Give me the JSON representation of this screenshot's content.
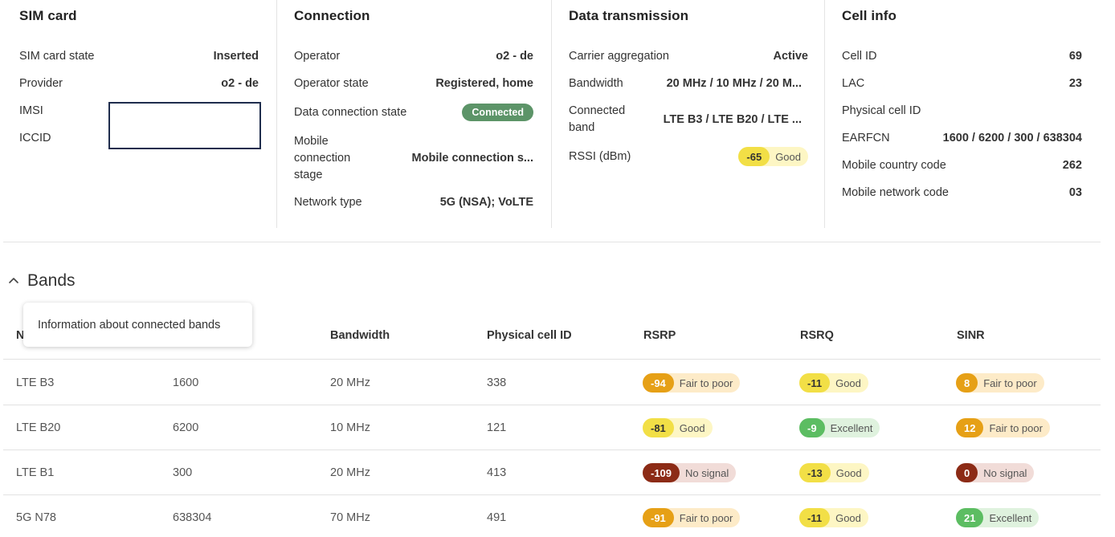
{
  "sim_card": {
    "title": "SIM card",
    "rows": [
      {
        "label": "SIM card state",
        "value": "Inserted"
      },
      {
        "label": "Provider",
        "value": "o2 - de"
      },
      {
        "label": "IMSI",
        "value": ""
      },
      {
        "label": "ICCID",
        "value": ""
      }
    ]
  },
  "connection": {
    "title": "Connection",
    "rows": [
      {
        "label": "Operator",
        "value": "o2 - de"
      },
      {
        "label": "Operator state",
        "value": "Registered, home"
      },
      {
        "label": "Data connection state",
        "value": "Connected"
      },
      {
        "label": "Mobile connection stage",
        "value": "Mobile connection s..."
      },
      {
        "label": "Network type",
        "value": "5G (NSA); VoLTE"
      }
    ]
  },
  "data_transmission": {
    "title": "Data transmission",
    "rows": [
      {
        "label": "Carrier aggregation",
        "value": "Active"
      },
      {
        "label": "Bandwidth",
        "value": "20 MHz / 10 MHz / 20 M..."
      },
      {
        "label": "Connected band",
        "value": "LTE B3 / LTE B20 / LTE ..."
      },
      {
        "label": "RSSI (dBm)",
        "value": "-65",
        "status": "Good"
      }
    ]
  },
  "cell_info": {
    "title": "Cell info",
    "rows": [
      {
        "label": "Cell ID",
        "value": "69"
      },
      {
        "label": "LAC",
        "value": "23"
      },
      {
        "label": "Physical cell ID",
        "value": ""
      },
      {
        "label": "EARFCN",
        "value": "1600 / 6200 / 300 / 638304"
      },
      {
        "label": "Mobile country code",
        "value": "262"
      },
      {
        "label": "Mobile network code",
        "value": "03"
      }
    ]
  },
  "bands": {
    "title": "Bands",
    "tooltip": "Information about connected bands",
    "columns": [
      "N",
      "",
      "Bandwidth",
      "Physical cell ID",
      "RSRP",
      "RSRQ",
      "SINR"
    ],
    "rows": [
      {
        "name": "LTE B3",
        "earfcn": "1600",
        "bandwidth": "20 MHz",
        "pci": "338",
        "rsrp": {
          "value": "-94",
          "status": "Fair to poor"
        },
        "rsrq": {
          "value": "-11",
          "status": "Good"
        },
        "sinr": {
          "value": "8",
          "status": "Fair to poor"
        }
      },
      {
        "name": "LTE B20",
        "earfcn": "6200",
        "bandwidth": "10 MHz",
        "pci": "121",
        "rsrp": {
          "value": "-81",
          "status": "Good"
        },
        "rsrq": {
          "value": "-9",
          "status": "Excellent"
        },
        "sinr": {
          "value": "12",
          "status": "Fair to poor"
        }
      },
      {
        "name": "LTE B1",
        "earfcn": "300",
        "bandwidth": "20 MHz",
        "pci": "413",
        "rsrp": {
          "value": "-109",
          "status": "No signal"
        },
        "rsrq": {
          "value": "-13",
          "status": "Good"
        },
        "sinr": {
          "value": "0",
          "status": "No signal"
        }
      },
      {
        "name": "5G N78",
        "earfcn": "638304",
        "bandwidth": "70 MHz",
        "pci": "491",
        "rsrp": {
          "value": "-91",
          "status": "Fair to poor"
        },
        "rsrq": {
          "value": "-11",
          "status": "Good"
        },
        "sinr": {
          "value": "21",
          "status": "Excellent"
        }
      }
    ]
  },
  "colors": {
    "connected_pill": "#5c9468",
    "good": "#f2df46",
    "fair_to_poor": "#e6a016",
    "excellent": "#5cbd62",
    "no_signal": "#8c2b16"
  }
}
